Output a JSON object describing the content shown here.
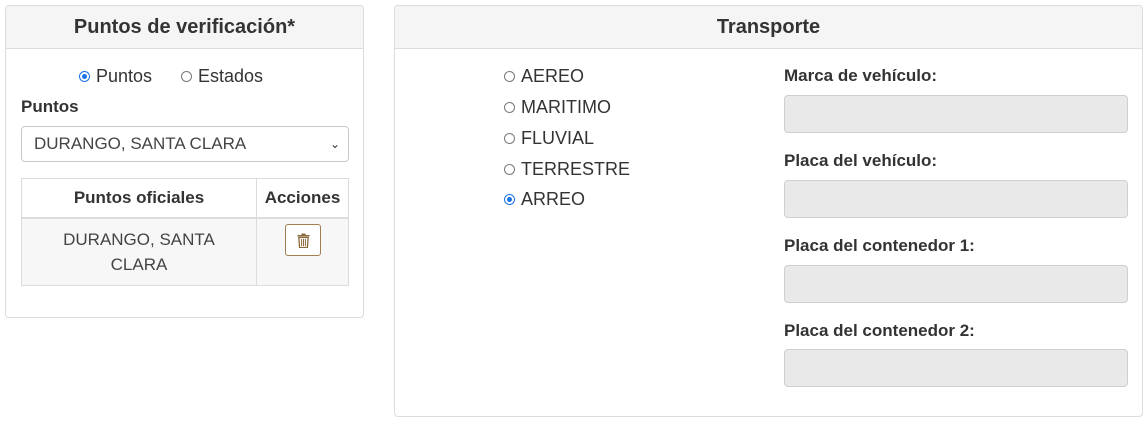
{
  "verification": {
    "title": "Puntos de verificación*",
    "mode_options": [
      {
        "label": "Puntos",
        "selected": true
      },
      {
        "label": "Estados",
        "selected": false
      }
    ],
    "points_label": "Puntos",
    "points_select_value": "DURANGO, SANTA CLARA",
    "table": {
      "headers": [
        "Puntos oficiales",
        "Acciones"
      ],
      "rows": [
        {
          "point_line1": "DURANGO, SANTA",
          "point_line2": "CLARA",
          "action_icon": "trash-icon"
        }
      ]
    }
  },
  "transport": {
    "title": "Transporte",
    "options": [
      {
        "label": "AEREO",
        "selected": false
      },
      {
        "label": "MARITIMO",
        "selected": false
      },
      {
        "label": "FLUVIAL",
        "selected": false
      },
      {
        "label": "TERRESTRE",
        "selected": false
      },
      {
        "label": "ARREO",
        "selected": true
      }
    ],
    "fields": [
      {
        "label": "Marca de vehículo:",
        "value": ""
      },
      {
        "label": "Placa del vehículo:",
        "value": ""
      },
      {
        "label": "Placa del contenedor 1:",
        "value": ""
      },
      {
        "label": "Placa del contenedor 2:",
        "value": ""
      }
    ]
  },
  "colors": {
    "radio_selected": "#1a73e8",
    "action_button_border": "#a08050",
    "disabled_input_bg": "#e9e9e9"
  }
}
